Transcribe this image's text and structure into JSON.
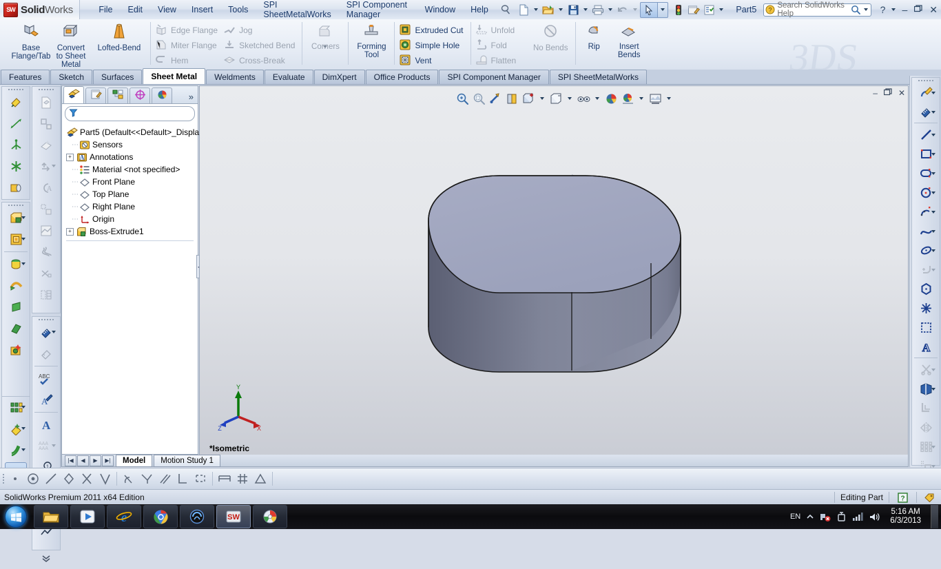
{
  "app": {
    "brand_bold": "Solid",
    "brand_light": "Works",
    "document_title": "Part5",
    "edition": "SolidWorks Premium 2011 x64 Edition"
  },
  "menu": {
    "items": [
      {
        "label": "File"
      },
      {
        "label": "Edit"
      },
      {
        "label": "View"
      },
      {
        "label": "Insert"
      },
      {
        "label": "Tools"
      },
      {
        "label": "SPI SheetMetalWorks"
      },
      {
        "label": "SPI Component Manager"
      },
      {
        "label": "Window"
      },
      {
        "label": "Help"
      }
    ]
  },
  "quick_access": {
    "icons": [
      "new-document-icon",
      "open-folder-icon",
      "save-icon",
      "print-icon",
      "undo-icon",
      "select-arrow-icon",
      "rebuild-icon",
      "options-icon",
      "settings-list-icon"
    ]
  },
  "search": {
    "placeholder": "Search SolidWorks Help",
    "icon": "help-question-icon",
    "magnifier": "magnifier-icon"
  },
  "window_buttons": {
    "help": "?",
    "minimize": "–",
    "restore": "❐",
    "close": "✕"
  },
  "ribbon": {
    "group1": [
      {
        "label": "Base\nFlange/Tab",
        "icon": "base-flange-icon",
        "enabled": true
      },
      {
        "label": "Convert\nto Sheet\nMetal",
        "icon": "convert-sheet-metal-icon",
        "enabled": true
      },
      {
        "label": "Lofted-Bend",
        "icon": "lofted-bend-icon",
        "enabled": true
      }
    ],
    "group2_col1": [
      {
        "label": "Edge Flange",
        "icon": "edge-flange-icon",
        "enabled": false
      },
      {
        "label": "Miter Flange",
        "icon": "miter-flange-icon",
        "enabled": false
      },
      {
        "label": "Hem",
        "icon": "hem-icon",
        "enabled": false
      }
    ],
    "group2_col2": [
      {
        "label": "Jog",
        "icon": "jog-icon",
        "enabled": false
      },
      {
        "label": "Sketched Bend",
        "icon": "sketched-bend-icon",
        "enabled": false
      },
      {
        "label": "Cross-Break",
        "icon": "cross-break-icon",
        "enabled": false
      }
    ],
    "corners": {
      "label": "Corners",
      "icon": "corners-icon",
      "enabled": false
    },
    "forming_tool": {
      "label": "Forming\nTool",
      "icon": "forming-tool-icon",
      "enabled": true
    },
    "group4": [
      {
        "label": "Extruded Cut",
        "icon": "extruded-cut-icon",
        "enabled": true
      },
      {
        "label": "Simple Hole",
        "icon": "simple-hole-icon",
        "enabled": true
      },
      {
        "label": "Vent",
        "icon": "vent-icon",
        "enabled": true
      }
    ],
    "group5": [
      {
        "label": "Unfold",
        "icon": "unfold-icon",
        "enabled": false
      },
      {
        "label": "Fold",
        "icon": "fold-icon",
        "enabled": false
      },
      {
        "label": "Flatten",
        "icon": "flatten-icon",
        "enabled": false
      }
    ],
    "no_bends": {
      "label": "No Bends",
      "icon": "no-bends-icon",
      "enabled": false
    },
    "rip": {
      "label": "Rip",
      "icon": "rip-icon",
      "enabled": true
    },
    "insert_bends": {
      "label": "Insert\nBends",
      "icon": "insert-bends-icon",
      "enabled": true
    },
    "watermark": "3DS"
  },
  "command_tabs": [
    {
      "label": "Features",
      "active": false
    },
    {
      "label": "Sketch",
      "active": false
    },
    {
      "label": "Surfaces",
      "active": false
    },
    {
      "label": "Sheet Metal",
      "active": true
    },
    {
      "label": "Weldments",
      "active": false
    },
    {
      "label": "Evaluate",
      "active": false
    },
    {
      "label": "DimXpert",
      "active": false
    },
    {
      "label": "Office Products",
      "active": false
    },
    {
      "label": "SPI Component Manager",
      "active": false
    },
    {
      "label": "SPI SheetMetalWorks",
      "active": false
    }
  ],
  "tree_panel": {
    "tabs": [
      {
        "icon": "feature-manager-tree-icon",
        "active": true
      },
      {
        "icon": "property-manager-icon",
        "active": false
      },
      {
        "icon": "configuration-manager-icon",
        "active": false
      },
      {
        "icon": "dimxpert-manager-icon",
        "active": false
      },
      {
        "icon": "display-manager-icon",
        "active": false
      }
    ],
    "more": "»",
    "filter_icon": "filter-funnel-icon",
    "items": [
      {
        "label": "Part5  (Default<<Default>_Displa",
        "icon": "part-icon",
        "expandable": false,
        "indent": 0
      },
      {
        "label": "Sensors",
        "icon": "sensors-icon",
        "expandable": false,
        "indent": 1
      },
      {
        "label": "Annotations",
        "icon": "annotations-icon",
        "expandable": true,
        "indent": 1
      },
      {
        "label": "Material <not specified>",
        "icon": "material-icon",
        "expandable": false,
        "indent": 1
      },
      {
        "label": "Front Plane",
        "icon": "plane-icon",
        "expandable": false,
        "indent": 1
      },
      {
        "label": "Top Plane",
        "icon": "plane-icon",
        "expandable": false,
        "indent": 1
      },
      {
        "label": "Right Plane",
        "icon": "plane-icon",
        "expandable": false,
        "indent": 1
      },
      {
        "label": "Origin",
        "icon": "origin-icon",
        "expandable": false,
        "indent": 1
      },
      {
        "label": "Boss-Extrude1",
        "icon": "boss-extrude-icon",
        "expandable": true,
        "indent": 1
      }
    ]
  },
  "graphics": {
    "view_label": "*Isometric",
    "triad": {
      "x": "X",
      "y": "Y",
      "z": "Z"
    },
    "hud_buttons": [
      "zoom-to-fit-icon",
      "zoom-to-area-icon",
      "previous-view-icon",
      "section-view-icon",
      "view-orientation-icon",
      "display-style-icon",
      "hide-show-items-icon",
      "edit-appearance-icon",
      "apply-scene-icon",
      "view-settings-icon"
    ],
    "window_buttons": {
      "minimize": "–",
      "restore": "❐",
      "close": "✕"
    }
  },
  "graphics_tabs": {
    "nav": [
      "◀│",
      "◀",
      "▶",
      "│▶"
    ],
    "tabs": [
      {
        "label": "Model",
        "active": true
      },
      {
        "label": "Motion Study 1",
        "active": false
      }
    ]
  },
  "sketch_toolbar": {
    "icons": [
      "point-relation-icon",
      "concentric-icon",
      "collinear-icon",
      "equal-icon",
      "intersection-icon",
      "midpoint-icon",
      "tangent-icon",
      "pierce-icon",
      "parallel-icon",
      "perpendicular-icon",
      "coincident-icon",
      "symmetric-icon",
      "grid-icon",
      "angle-icon"
    ]
  },
  "status_bar": {
    "edition": "SolidWorks Premium 2011 x64 Edition",
    "mode": "Editing Part",
    "help_icon": "help-question-icon",
    "tag_icon": "tag-icon"
  },
  "taskbar": {
    "start": "windows-start-orb",
    "apps": [
      {
        "icon": "file-explorer-icon"
      },
      {
        "icon": "media-player-icon"
      },
      {
        "icon": "internet-explorer-icon"
      },
      {
        "icon": "google-chrome-icon"
      },
      {
        "icon": "media-app-icon"
      },
      {
        "icon": "solidworks-app-icon"
      },
      {
        "icon": "paint-app-icon"
      }
    ],
    "tray": {
      "language": "EN",
      "icons": [
        "show-hidden-icons-arrow",
        "network-error-icon",
        "battery-icon",
        "signal-bars-icon",
        "volume-icon"
      ],
      "time": "5:16 AM",
      "date": "6/3/2013"
    }
  },
  "left_toolbars": {
    "col_a_top": [
      "sketch-fillet-icon",
      "sketch-line-icon",
      "reference-geometry-icon",
      "point-pattern-icon",
      "instant3d-icon"
    ],
    "col_a_mid": [
      "extruded-boss-icon",
      "extruded-cut-icon",
      "revolved-boss-icon",
      "swept-boss-icon",
      "lofted-boss-icon",
      "boundary-boss-icon"
    ],
    "col_a_bottom": [
      "linear-pattern-icon",
      "fillet-icon",
      "draft-icon",
      "rib-icon",
      "shell-icon"
    ],
    "col_b_top": [
      "new-part-icon",
      "layout-icon",
      "smart-fasteners-icon",
      "move-component-icon",
      "circular-note-icon",
      "assembly-feature-icon",
      "exploded-view-icon",
      "belt-chain-icon",
      "cut-list-icon",
      "bom-icon"
    ],
    "col_b_bottom": [
      "smart-dimension-icon",
      "dimxpert-icon",
      "spell-check-icon",
      "note-icon",
      "text-icon",
      "multi-note-icon",
      "balloon-icon",
      "auto-balloon-icon",
      "surface-finish-icon",
      "weld-symbol-icon",
      "more-chevrons-icon"
    ]
  },
  "right_toolbars": {
    "top": [
      "sketch-edit-icon",
      "smart-dimension-icon"
    ],
    "entities": [
      "line-icon",
      "rectangle-icon",
      "slot-icon",
      "circle-icon",
      "arc-icon",
      "spline-icon",
      "ellipse-icon",
      "fillet-icon",
      "polygon-icon",
      "point-icon"
    ],
    "tools": [
      "pattern-icon",
      "text-icon",
      "trim-icon",
      "offset-icon",
      "convert-entities-icon",
      "mirror-icon",
      "linear-pattern-icon",
      "move-entities-icon",
      "jog-line-icon",
      "repair-sketch-icon",
      "more-chevrons-icon"
    ]
  }
}
